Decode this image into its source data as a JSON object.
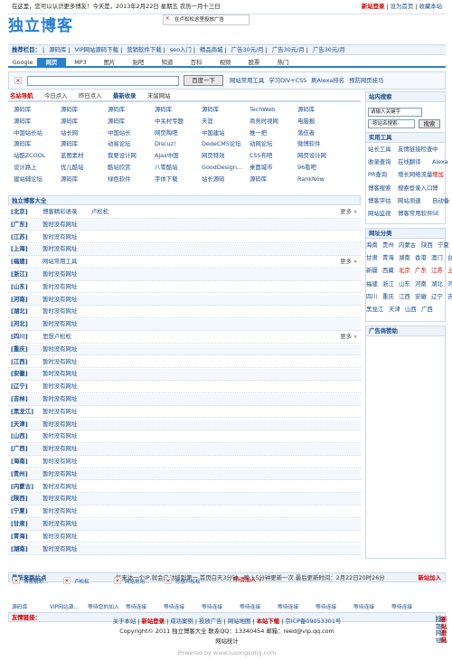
{
  "topbar": {
    "welcome": "在这里，您可以认识更多博友！今天是，2013年2月22日 星期五 农历一月十三日",
    "login": "新站登录",
    "homepage": "设为首页",
    "favorite": "收藏本站"
  },
  "logo": "独立博客",
  "top_ad": "在卢松松这里投放广告",
  "recommend": {
    "label": "推荐栏目：",
    "items": [
      "源码库",
      "VIP网站源码下载",
      "营销软件下载",
      "seo入门",
      "精品商城",
      "广告30元/月",
      "广告30元/月",
      "广告30元/月"
    ]
  },
  "search_tabs": [
    "Google",
    "网页",
    "MP3",
    "图片",
    "贴吧",
    "知道",
    "百科",
    "视频",
    "股票",
    "热门"
  ],
  "search": {
    "button": "百度一下",
    "links": [
      "网站常用工具",
      "学习DIV+CSS",
      "刷Alexa排名",
      "预防网页挂马"
    ]
  },
  "nav_tabs": [
    "名站导航",
    "今日点入",
    "昨日点入",
    "最新收录",
    "末留网站"
  ],
  "nav_grid": [
    [
      "源码库",
      "源码库",
      "源码库",
      "源码库",
      "源码库",
      "TechWeb",
      "源码库"
    ],
    [
      "源码库",
      "源码库",
      "源码库",
      "中关村专题",
      "天涯",
      "商务时视网",
      "电脑报"
    ],
    [
      "中国站长站",
      "站长网",
      "中国站长",
      "网页陶吧",
      "中国建站",
      "推一把",
      "落伍者"
    ],
    [
      "源码库",
      "源码库",
      "动易论坛",
      "Discuz!",
      "DedeCMS论坛",
      "动网论坛",
      "微博软件"
    ],
    [
      "站酷ZCOOL",
      "蓝图素材",
      "我要设计网",
      "Ajax中国",
      "网页特效",
      "CSS布吧",
      "网页设计网"
    ],
    [
      "设计路上",
      "优儿酷站",
      "酷站欣赏",
      "八零酷站",
      "GoodDesign...",
      "桌面城市",
      "96看吧"
    ],
    [
      "建站辅论坛",
      "源码库",
      "绿色软件",
      "字体下载",
      "站长源码",
      "源码库",
      "RankNow"
    ]
  ],
  "dir": {
    "title": "独立博客大全",
    "more": "更多 »",
    "rows": [
      {
        "name": "[北京]",
        "value": "博客精彩语录",
        "value2": "卢松松",
        "more": true
      },
      {
        "name": "[广东]",
        "value": "暂时没有网址",
        "value2": "",
        "more": false
      },
      {
        "name": "[江苏]",
        "value": "暂时没有网址",
        "value2": "",
        "more": false
      },
      {
        "name": "[上海]",
        "value": "暂时没有网址",
        "value2": "",
        "more": false
      },
      {
        "name": "[福建]",
        "value": "网站常用工具",
        "value2": "",
        "more": true
      },
      {
        "name": "[浙江]",
        "value": "暂时没有网址",
        "value2": "",
        "more": false
      },
      {
        "name": "[山东]",
        "value": "暂时没有网址",
        "value2": "",
        "more": false
      },
      {
        "name": "[河南]",
        "value": "暂时没有网址",
        "value2": "",
        "more": false
      },
      {
        "name": "[湖北]",
        "value": "暂时没有网址",
        "value2": "",
        "more": false
      },
      {
        "name": "[河北]",
        "value": "暂时没有网址",
        "value2": "",
        "more": false
      },
      {
        "name": "[四川]",
        "value": "思想卢松松",
        "value2": "",
        "more": true
      },
      {
        "name": "[重庆]",
        "value": "暂时没有网址",
        "value2": "",
        "more": false
      },
      {
        "name": "[江西]",
        "value": "暂时没有网址",
        "value2": "",
        "more": false
      },
      {
        "name": "[安徽]",
        "value": "暂时没有网址",
        "value2": "",
        "more": false
      },
      {
        "name": "[辽宁]",
        "value": "暂时没有网址",
        "value2": "",
        "more": false
      },
      {
        "name": "[吉林]",
        "value": "暂时没有网址",
        "value2": "",
        "more": false
      },
      {
        "name": "[黑龙江]",
        "value": "暂时没有网址",
        "value2": "",
        "more": false
      },
      {
        "name": "[天津]",
        "value": "暂时没有网址",
        "value2": "",
        "more": false
      },
      {
        "name": "[山西]",
        "value": "暂时没有网址",
        "value2": "",
        "more": false
      },
      {
        "name": "[广西]",
        "value": "暂时没有网址",
        "value2": "",
        "more": false
      },
      {
        "name": "[海南]",
        "value": "暂时没有网址",
        "value2": "",
        "more": false
      },
      {
        "name": "[贵州]",
        "value": "暂时没有网址",
        "value2": "",
        "more": false
      },
      {
        "name": "[内蒙古]",
        "value": "暂时没有网址",
        "value2": "",
        "more": false
      },
      {
        "name": "[陕西]",
        "value": "暂时没有网址",
        "value2": "",
        "more": false
      },
      {
        "name": "[宁夏]",
        "value": "暂时没有网址",
        "value2": "",
        "more": false
      },
      {
        "name": "[甘肃]",
        "value": "暂时没有网址",
        "value2": "",
        "more": false
      },
      {
        "name": "[青海]",
        "value": "暂时没有网址",
        "value2": "",
        "more": false
      },
      {
        "name": "[湖南]",
        "value": "暂时没有网址",
        "value2": "",
        "more": false
      }
    ]
  },
  "new_sites": {
    "title": "最新来路站点",
    "notice": "每来访一个IP,就会自动排到第一 首页白天3分钟，晚上5分钟更新一次 最后更新时间：2月22日20时26分",
    "join": "新站加入",
    "items": [
      "博客精彩...",
      "卢松松",
      "网站常用...",
      "思想卢松松"
    ],
    "apply": "申请加入 »"
  },
  "friend": {
    "title": "友情链接：",
    "links_right": [
      "投靠网址",
      "更多链接",
      "新站登陆"
    ],
    "items": [
      "源码库",
      "VIP网站源...",
      "等待您的加入",
      "等待连接",
      "等待连接",
      "等待连接",
      "等待连接",
      "等待连接",
      "等待连接",
      "等待连接",
      "等待连接"
    ]
  },
  "footer": {
    "links": [
      "关于本站",
      "新站登录",
      "成功案例",
      "投放广告",
      "网站地图",
      "本站下载",
      "京ICP备09053301号"
    ],
    "copyright": "Copyright© 2011 独立博客大全 联系QQ：13340454 邮箱：reed@vip.qq.com",
    "stats": "网站统计",
    "powered": "Powered by www.lusongsong.com"
  },
  "side": {
    "search_title": "站内搜索",
    "search_placeholder": "请输入关键字",
    "select": "-按站名搜索-",
    "search_btn": "搜索",
    "tools_title": "实用工具",
    "tools": [
      [
        "站长工具",
        "友情链接检查",
        "中"
      ],
      [
        "收录查询",
        "在线翻译",
        "Alexa"
      ],
      [
        "PR查询",
        "增长网络流量",
        "增加"
      ],
      [
        "博客搜索",
        "搜索登录入口",
        "博"
      ],
      [
        "博客评估",
        "网站测速",
        "自动备"
      ],
      [
        "网站监视",
        "博客常用软件",
        "SE"
      ]
    ],
    "region_title": "网址分类",
    "regions": [
      [
        "海南",
        "贵州",
        "内蒙古",
        "陕西",
        "宁夏"
      ],
      [
        "甘肃",
        "青海",
        "湖南",
        "香港",
        "澳门",
        "台"
      ],
      [
        "新疆",
        "西藏",
        "北京",
        "广东",
        "江苏",
        "上"
      ],
      [
        "福建",
        "浙江",
        "山东",
        "河南",
        "湖北",
        "河"
      ],
      [
        "四川",
        "重庆",
        "江西",
        "安徽",
        "辽宁",
        "吉"
      ],
      [
        "黑龙江",
        "天津",
        "山西",
        "广西"
      ]
    ],
    "ad_title": "广告商赞助"
  },
  "colors": {
    "accent": "#2a7fd0",
    "link": "#1a4b8c",
    "red": "#cc0000",
    "panel": "#eef3f9",
    "border": "#c9d9ec"
  }
}
